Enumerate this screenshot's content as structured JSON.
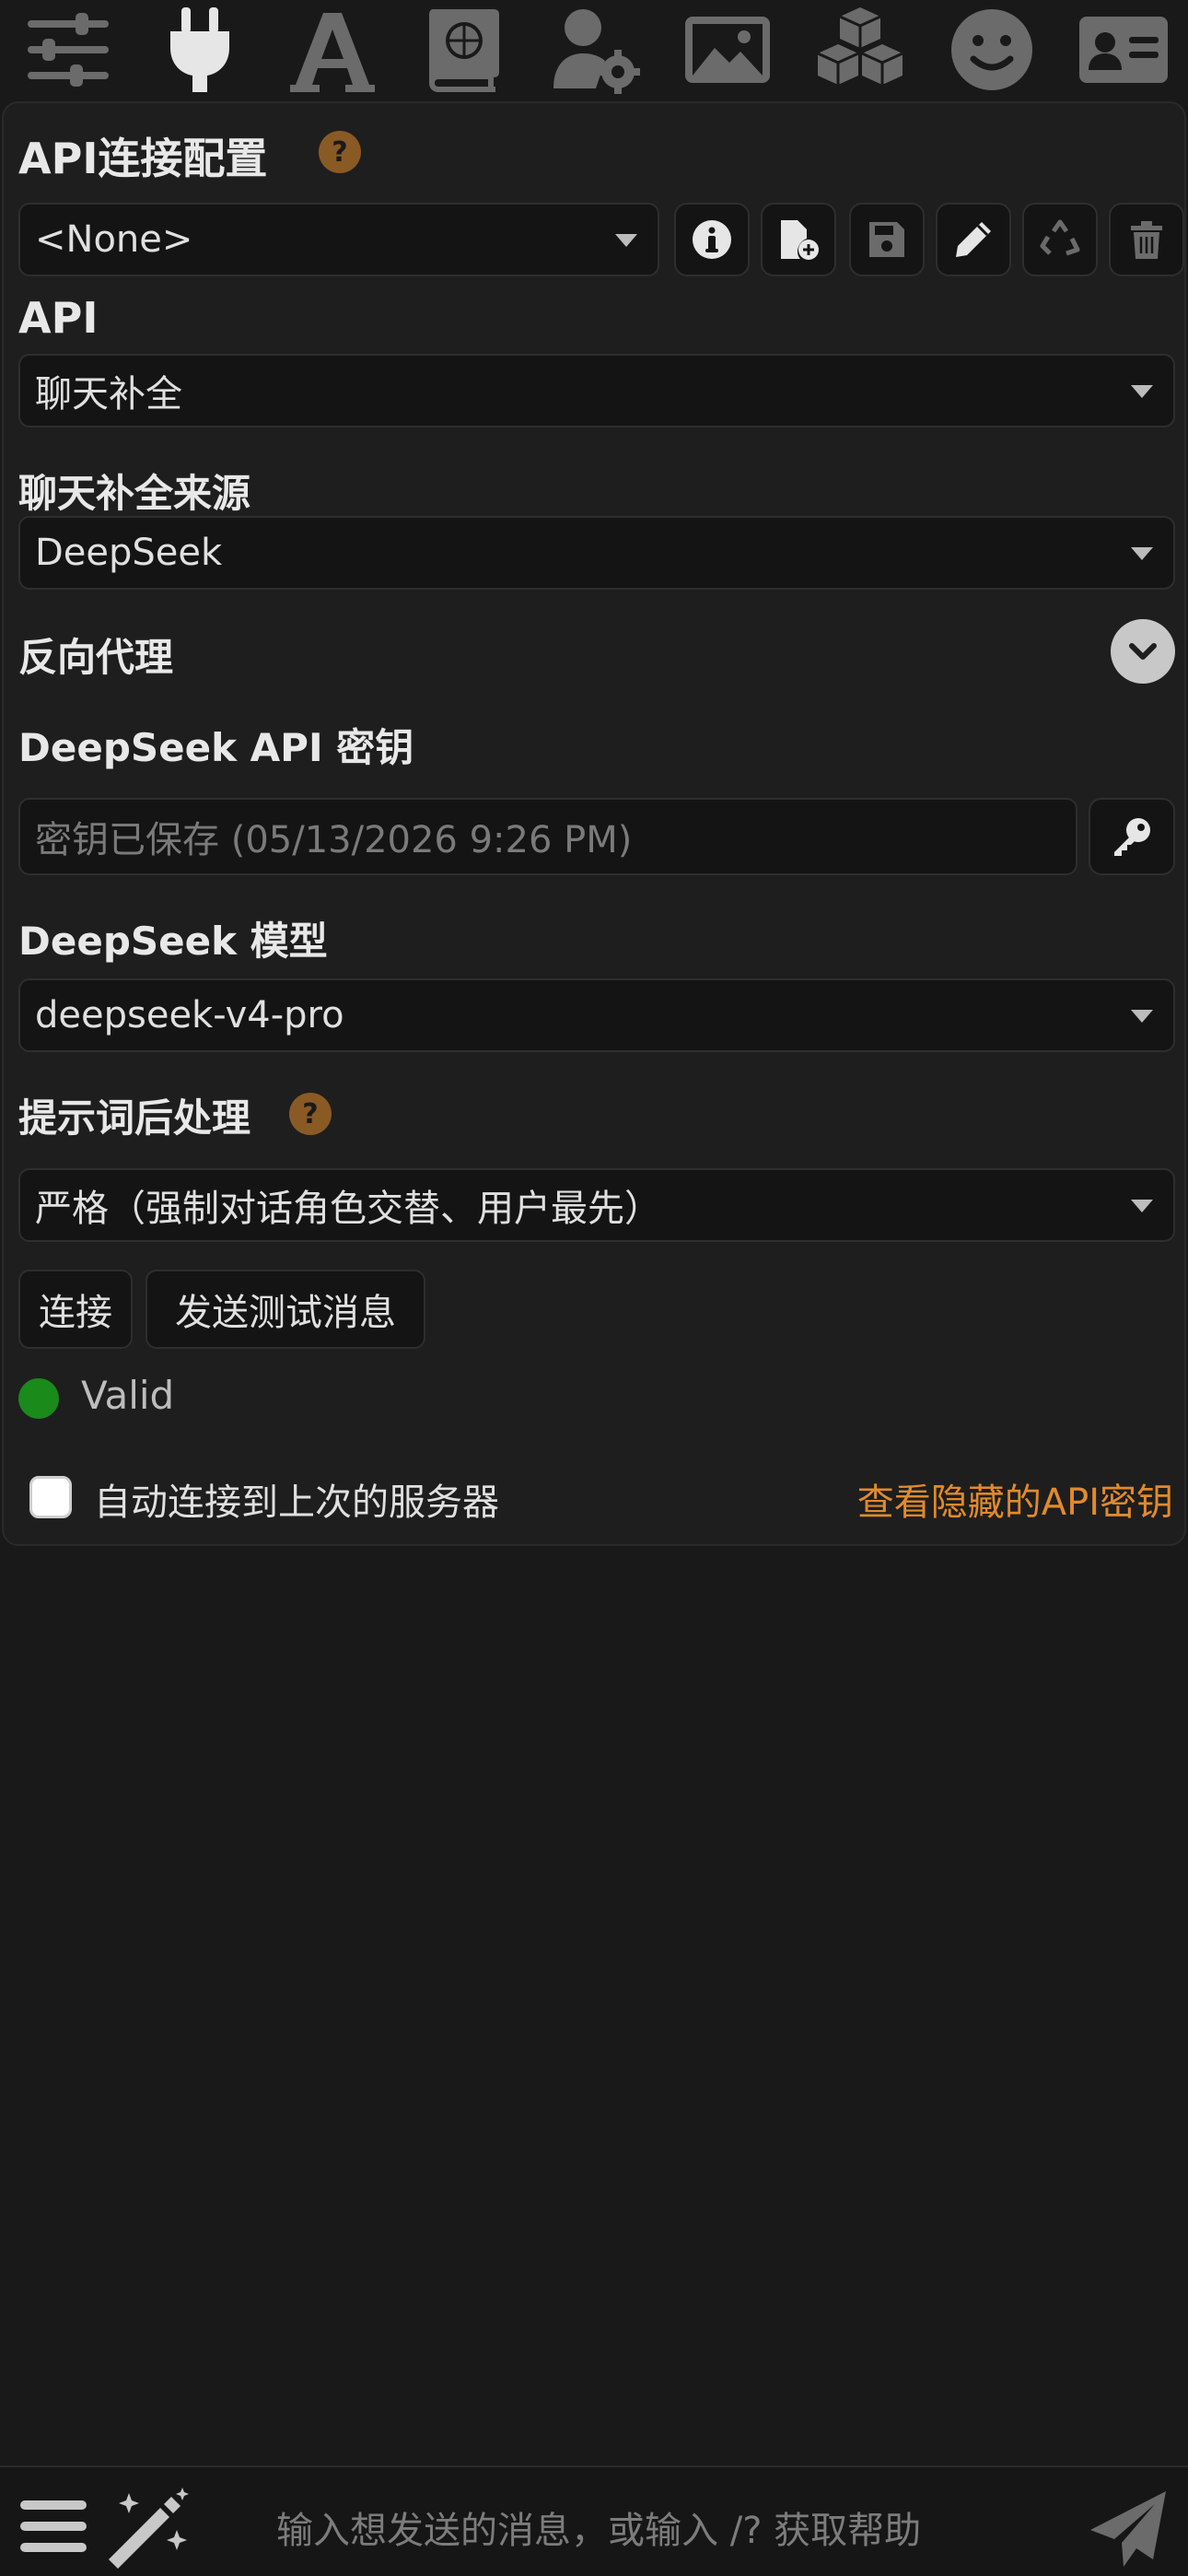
{
  "topnav": {
    "icons": [
      "sliders-icon",
      "plug-icon",
      "font-icon",
      "book-atlas-icon",
      "user-gear-icon",
      "image-icon",
      "cubes-icon",
      "face-smile-icon",
      "id-card-icon"
    ]
  },
  "connection_profile": {
    "heading": "API连接配置",
    "help": "?",
    "selected": "<None>"
  },
  "api": {
    "heading": "API",
    "selected": "聊天补全"
  },
  "chat_source": {
    "heading": "聊天补全来源",
    "selected": "DeepSeek"
  },
  "reverse_proxy": {
    "heading": "反向代理"
  },
  "api_key": {
    "heading": "DeepSeek API 密钥",
    "placeholder": "密钥已保存 (05/13/2026 9:26 PM)"
  },
  "model": {
    "heading": "DeepSeek 模型",
    "selected": "deepseek-v4-pro"
  },
  "prompt_post": {
    "heading": "提示词后处理",
    "help": "?",
    "selected": "严格（强制对话角色交替、用户最先）"
  },
  "actions": {
    "connect_label": "连接",
    "test_label": "发送测试消息"
  },
  "status": {
    "text": "Valid",
    "color": "#1a8a1a"
  },
  "auto_connect": {
    "label": "自动连接到上次的服务器",
    "checked": false
  },
  "hidden_keys_link": "查看隐藏的API密钥",
  "bottombar": {
    "input_placeholder": "输入想发送的消息，或输入 /? 获取帮助"
  },
  "colors": {
    "accent": "#e08a2c",
    "background": "#191919",
    "panel": "#1e1e1e",
    "help_badge": "#8a5a24"
  }
}
